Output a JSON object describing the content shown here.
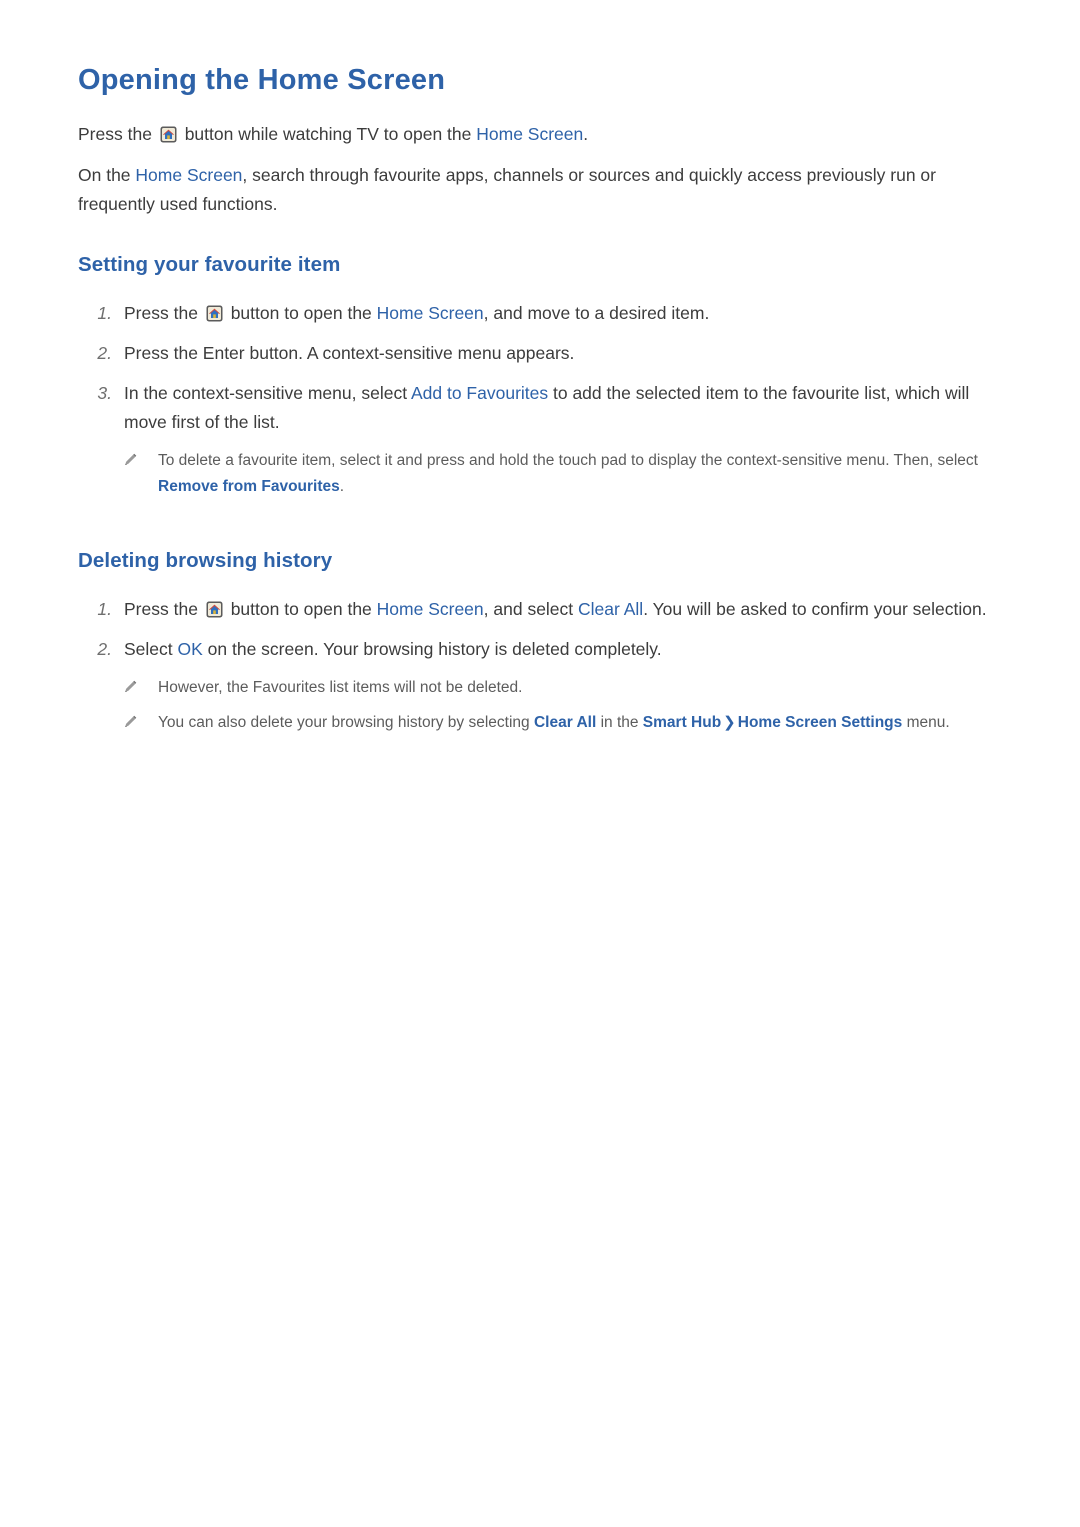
{
  "page": {
    "title": "Opening the Home Screen",
    "intro": {
      "p1_a": "Press the",
      "p1_icon": "home-button-icon",
      "p1_b": "button while watching TV to open the",
      "p1_link": "Home Screen",
      "p1_c": ".",
      "p2_a": "On the",
      "p2_link": "Home Screen",
      "p2_b": ", search through favourite apps, channels or sources and quickly access previously run or frequently used functions."
    },
    "section1": {
      "heading": "Setting your favourite item",
      "steps": [
        {
          "num": "1.",
          "a": "Press the",
          "icon": "home-button-icon",
          "b": "button to open the",
          "link": "Home Screen",
          "c": ", and move to a desired item."
        },
        {
          "num": "2.",
          "a": "Press the Enter button. A context-sensitive menu appears."
        },
        {
          "num": "3.",
          "a": "In the context-sensitive menu, select",
          "link": "Add to Favourites",
          "c": " to add the selected item to the favourite list, which will move first of the list."
        }
      ],
      "notes": [
        {
          "a": "To delete a favourite item, select it and press and hold the touch pad to display the context-sensitive menu. Then, select ",
          "link": "Remove from Favourites",
          "c": "."
        }
      ]
    },
    "section2": {
      "heading": "Deleting browsing history",
      "steps": [
        {
          "num": "1.",
          "a": "Press the",
          "icon": "home-button-icon",
          "b": "button to open the",
          "link": "Home Screen",
          "c": ", and select ",
          "link2": "Clear All",
          "d": ". You will be asked to confirm your selection."
        },
        {
          "num": "2.",
          "a": "Select ",
          "link": "OK",
          "c": " on the screen. Your browsing history is deleted completely."
        }
      ],
      "notes": [
        {
          "a": "However, the Favourites list items will not be deleted."
        },
        {
          "a": "You can also delete your browsing history by selecting ",
          "link": "Clear All",
          "b": " in the ",
          "link2": "Smart Hub",
          "chev": "❯",
          "link3": "Home Screen Settings",
          "c": " menu."
        }
      ]
    },
    "colors": {
      "heading_blue": "#2e62a8",
      "body_gray": "#3c3c3c",
      "note_gray": "#5c5c5c"
    }
  }
}
